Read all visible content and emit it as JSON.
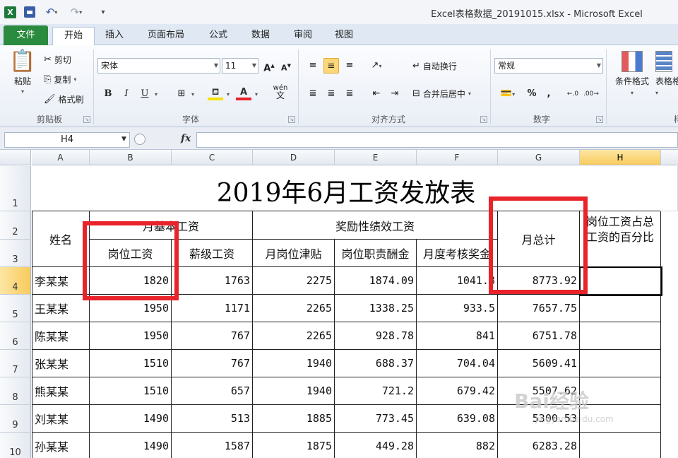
{
  "window": {
    "title": "Excel表格数据_20191015.xlsx - Microsoft Excel",
    "app_icon": "X"
  },
  "tabs": [
    "文件",
    "开始",
    "插入",
    "页面布局",
    "公式",
    "数据",
    "审阅",
    "视图"
  ],
  "ribbon": {
    "clipboard": {
      "paste": "粘贴",
      "cut": "剪切",
      "copy": "复制",
      "format_painter": "格式刷",
      "label": "剪贴板"
    },
    "font": {
      "name": "宋体",
      "size": "11",
      "bold": "B",
      "italic": "I",
      "underline": "U",
      "label": "字体",
      "wen": "wén"
    },
    "alignment": {
      "wrap": "自动换行",
      "merge": "合并后居中",
      "label": "对齐方式"
    },
    "number": {
      "format": "常规",
      "percent": "%",
      "comma": ",",
      "label": "数字"
    },
    "styles": {
      "conditional": "条件格式",
      "table": "表格格",
      "label_partial": "样"
    }
  },
  "formula_bar": {
    "name_box": "H4",
    "fx": "fx",
    "value": ""
  },
  "sheet": {
    "columns": [
      "A",
      "B",
      "C",
      "D",
      "E",
      "F",
      "G",
      "H"
    ],
    "selected_col": "H",
    "rows": [
      "1",
      "2",
      "3",
      "4",
      "5",
      "6",
      "7",
      "8",
      "9",
      "10"
    ],
    "selected_row": "4",
    "title": "2019年6月工资发放表",
    "headers": {
      "name": "姓名",
      "base_salary": "月基本工资",
      "post_salary": "岗位工资",
      "grade_salary": "薪级工资",
      "performance": "奖励性绩效工资",
      "post_allowance": "月岗位津贴",
      "duty_pay": "岗位职责酬金",
      "monthly_bonus": "月度考核奖金",
      "monthly_total": "月总计",
      "post_pct": "岗位工资占总工资的百分比"
    },
    "data": [
      [
        "李某某",
        "1820",
        "1763",
        "2275",
        "1874.09",
        "1041.8",
        "8773.92",
        ""
      ],
      [
        "王某某",
        "1950",
        "1171",
        "2265",
        "1338.25",
        "933.5",
        "7657.75",
        ""
      ],
      [
        "陈某某",
        "1950",
        "767",
        "2265",
        "928.78",
        "841",
        "6751.78",
        ""
      ],
      [
        "张某某",
        "1510",
        "767",
        "1940",
        "688.37",
        "704.04",
        "5609.41",
        ""
      ],
      [
        "熊某某",
        "1510",
        "657",
        "1940",
        "721.2",
        "679.42",
        "5507.62",
        ""
      ],
      [
        "刘某某",
        "1490",
        "513",
        "1885",
        "773.45",
        "639.08",
        "5300.53",
        ""
      ],
      [
        "孙某某",
        "1490",
        "1587",
        "1875",
        "449.28",
        "882",
        "6283.28",
        ""
      ]
    ]
  },
  "colors": {
    "highlight": "#e8232a",
    "file_tab": "#2a8a3e",
    "header_selected": "#f8cb5c"
  },
  "watermark": {
    "text": "Bai经验",
    "sub": "jingyan.baidu.com"
  }
}
